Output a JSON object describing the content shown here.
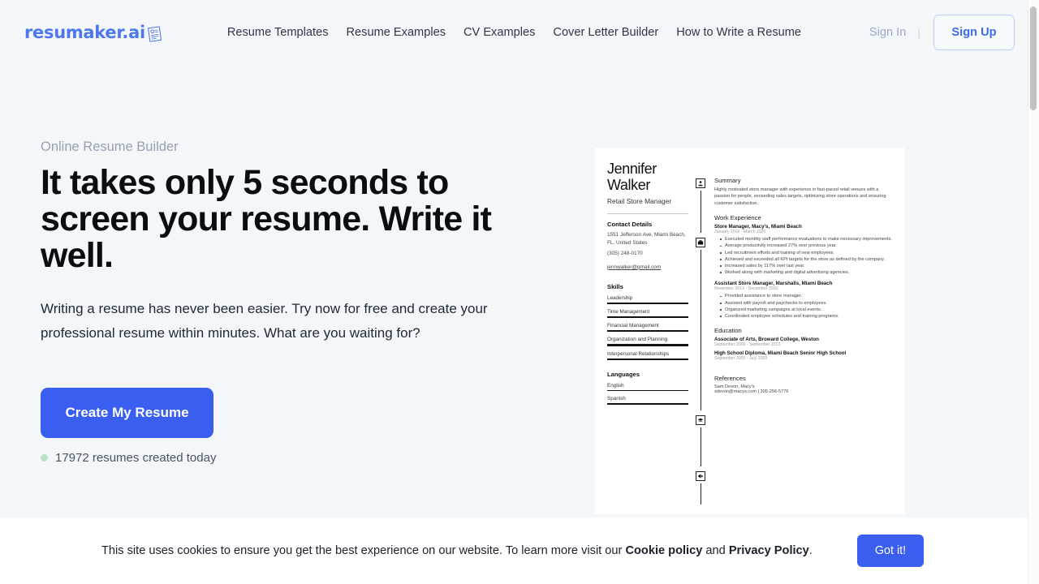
{
  "brand": {
    "name": "resumaker.ai",
    "logo_icon": "resume-document-icon",
    "color": "#4f78ef"
  },
  "nav": {
    "items": [
      {
        "label": "Resume Templates"
      },
      {
        "label": "Resume Examples"
      },
      {
        "label": "CV Examples"
      },
      {
        "label": "Cover Letter Builder"
      },
      {
        "label": "How to Write a Resume"
      }
    ],
    "sign_in": "Sign In",
    "divider": "|",
    "sign_up": "Sign Up"
  },
  "hero": {
    "eyebrow": "Online Resume Builder",
    "headline": "It takes only 5 seconds to screen your resume. Write it well.",
    "subtext": "Writing a resume has never been easier. Try now for free and create your professional resume within minutes. What are you waiting for?",
    "cta_label": "Create My Resume",
    "counter": "17972 resumes created today",
    "cta_color": "#3a5ef0",
    "dot_color": "#b7e3c2"
  },
  "resume_preview": {
    "name": "Jennifer Walker",
    "job_title": "Retail Store Manager",
    "contact_heading": "Contact Details",
    "address": "1551 Jefferson Ave, Miami Beach, FL, United States",
    "phone": "(305) 248-0170",
    "email": "jennwalker@gmail.com",
    "skills_heading": "Skills",
    "skills": [
      "Leadership",
      "Time Management",
      "Financial Management",
      "Organization and Planning",
      "Interpersonal Relationships"
    ],
    "languages_heading": "Languages",
    "languages": [
      "English",
      "Spanish"
    ],
    "summary_heading": "Summary",
    "summary_icon": "person-icon",
    "summary_text": "Highly motivated store manager with experience in fast-paced retail venues with a passion for people, exceeding sales targets, optimizing store operations and ensuring customer satisfaction.",
    "work_heading": "Work Experience",
    "work_icon": "briefcase-icon",
    "jobs": [
      {
        "title": "Store Manager, Macy's, Miami Beach",
        "dates": "January 2016 - March 2020",
        "bullets": [
          "Executed monthly staff performance evaluations to make necessary improvements.",
          "Average productivity increased 27% over previous year.",
          "Led recruitment efforts and training of new employees.",
          "Achieved and exceeded all KPI targets for the store as defined by the company.",
          "Increased sales by 117% over last year.",
          "Worked along with marketing and digital advertising agencies."
        ]
      },
      {
        "title": "Assistant Store Manager, Marshalls, Miami Beach",
        "dates": "November 2013 - December 2020",
        "bullets": [
          "Provided assistance to store manager.",
          "Assisted with payroll and paychecks to employees.",
          "Organized marketing campaigns at local events.",
          "Coordinated employee schedules and training programs."
        ]
      }
    ],
    "education_heading": "Education",
    "education_icon": "graduation-icon",
    "education": [
      {
        "title": "Associate of Arts, Broward College, Weston",
        "dates": "September 2009 - September 2013"
      },
      {
        "title": "High School Diploma, Miami Beach Senior High School",
        "dates": "September 2005 - July 2009"
      }
    ],
    "references_heading": "References",
    "references_icon": "megaphone-icon",
    "reference_name": "Sam Devon, Macy's",
    "reference_contact": "sdevon@macys.com | 305-256-5776"
  },
  "cookie_banner": {
    "text_part1": "This site uses cookies to ensure you get the best experience on our website. To learn more visit our ",
    "link1": "Cookie policy",
    "text_part2": " and ",
    "link2": "Privacy Policy",
    "text_part3": ".",
    "accept_label": "Got it!"
  }
}
